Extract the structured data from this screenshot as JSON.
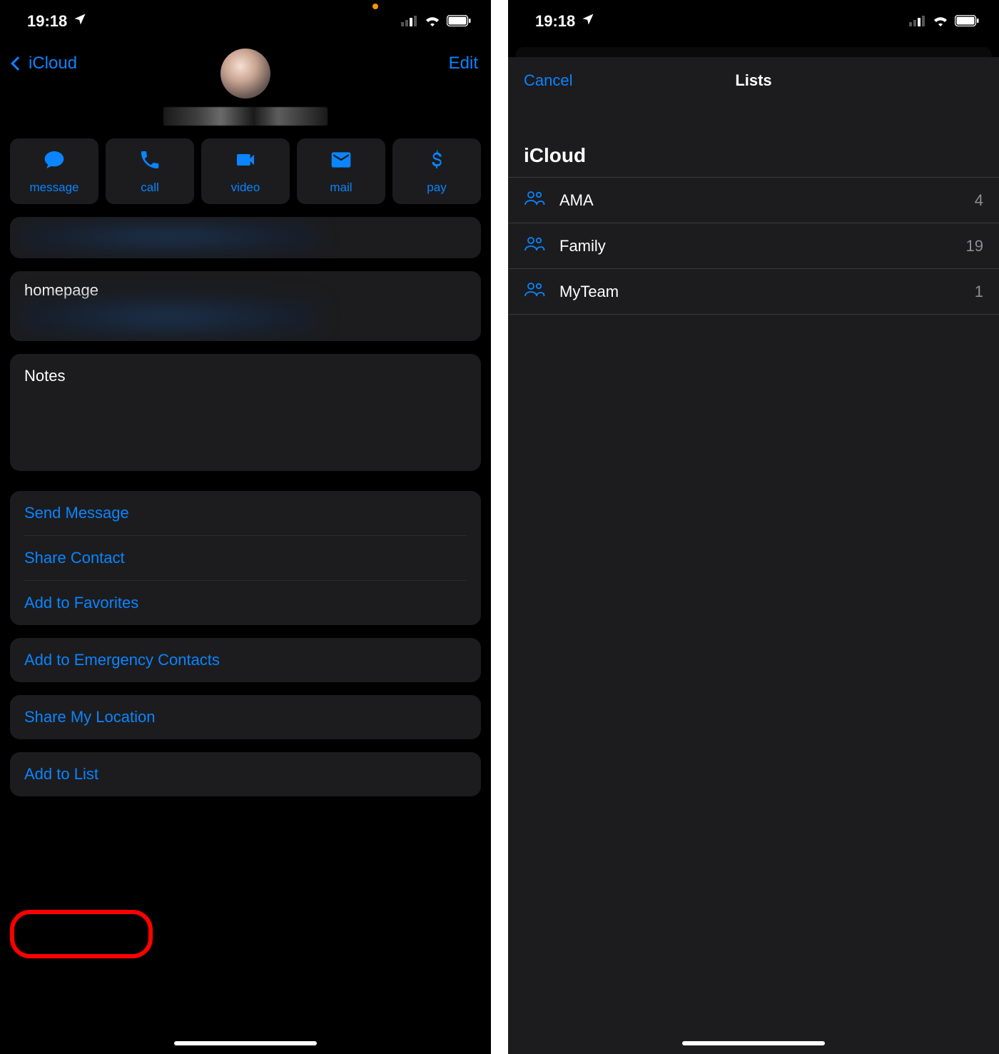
{
  "status": {
    "time": "19:18"
  },
  "left": {
    "nav": {
      "back_label": "iCloud",
      "edit_label": "Edit"
    },
    "quick": [
      {
        "icon": "message",
        "label": "message"
      },
      {
        "icon": "call",
        "label": "call"
      },
      {
        "icon": "video",
        "label": "video"
      },
      {
        "icon": "mail",
        "label": "mail"
      },
      {
        "icon": "pay",
        "label": "pay"
      }
    ],
    "homepage_label": "homepage",
    "notes_label": "Notes",
    "actions1": [
      {
        "label": "Send Message"
      },
      {
        "label": "Share Contact"
      },
      {
        "label": "Add to Favorites"
      }
    ],
    "emergency_label": "Add to Emergency Contacts",
    "share_location_label": "Share My Location",
    "add_to_list_label": "Add to List"
  },
  "right": {
    "sheet": {
      "cancel_label": "Cancel",
      "title": "Lists",
      "section": "iCloud",
      "items": [
        {
          "name": "AMA",
          "count": "4"
        },
        {
          "name": "Family",
          "count": "19"
        },
        {
          "name": "MyTeam",
          "count": "1"
        }
      ]
    }
  }
}
